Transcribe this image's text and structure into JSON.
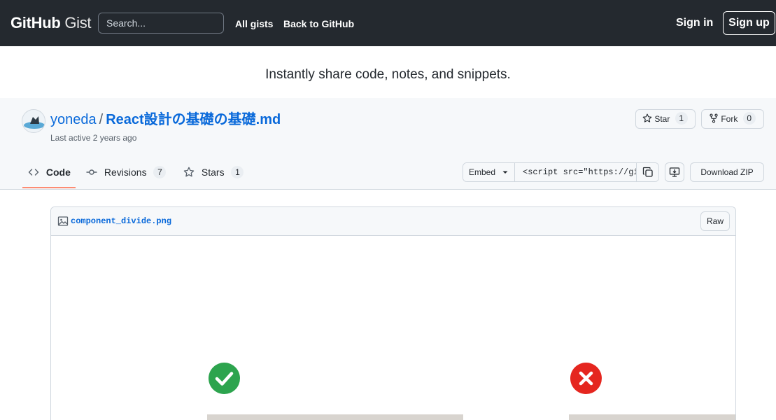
{
  "header": {
    "logo_bold": "GitHub",
    "logo_light": "Gist",
    "search_placeholder": "Search...",
    "nav": [
      "All gists",
      "Back to GitHub"
    ],
    "signin": "Sign in",
    "signup": "Sign up"
  },
  "tagline": "Instantly share code, notes, and snippets.",
  "gist": {
    "owner": "yoneda",
    "separator": "/",
    "filename": "React設計の基礎の基礎.md",
    "last_active": "Last active 2 years ago",
    "star": {
      "label": "Star",
      "count": "1"
    },
    "fork": {
      "label": "Fork",
      "count": "0"
    }
  },
  "tabs": [
    {
      "label": "Code",
      "count": null,
      "icon": "code-icon"
    },
    {
      "label": "Revisions",
      "count": "7",
      "icon": "git-commit-icon"
    },
    {
      "label": "Stars",
      "count": "1",
      "icon": "star-icon"
    }
  ],
  "embed": {
    "label": "Embed",
    "value": "<script src=\"https://gist.github.com/"
  },
  "download_label": "Download ZIP",
  "file": {
    "name": "component_divide.png",
    "raw_label": "Raw"
  },
  "colors": {
    "header_bg": "#24292f",
    "link": "#0969da",
    "check_green": "#2da44e",
    "cross_red": "#e5261f",
    "tab_underline": "#fd8c73"
  }
}
